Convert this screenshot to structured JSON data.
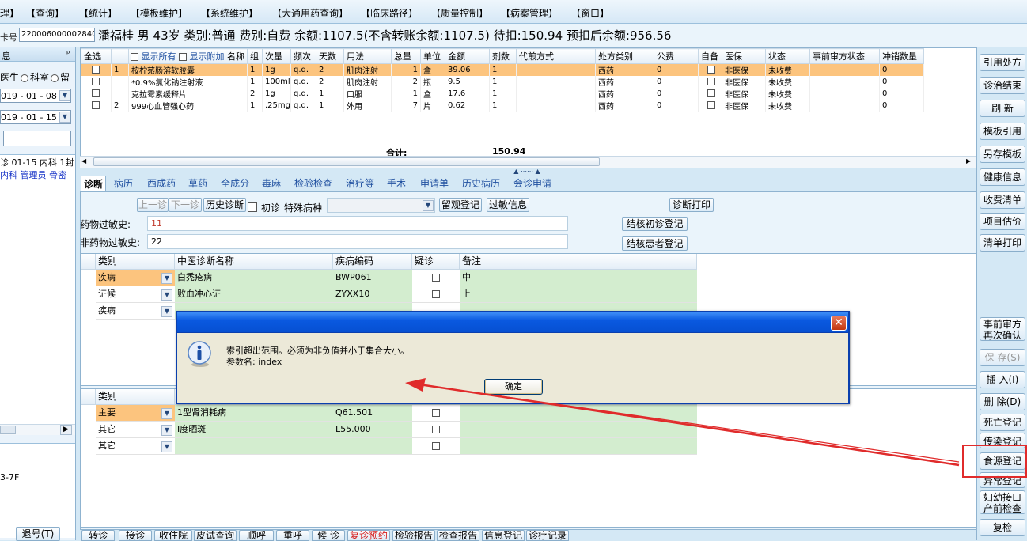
{
  "menu": [
    "理】",
    "【查询】",
    "【统计】",
    "【模板维护】",
    "【系统维护】",
    "【大通用药查询】",
    "【临床路径】",
    "【质量控制】",
    "【病案管理】",
    "【窗口】"
  ],
  "infobar": {
    "card_label": "卡号",
    "card_number": "220006000002840",
    "patient_line": "潘福桂  男  43岁  类别:普通  费别:自费  余额:1107.5(不含转账余额:1107.5)  待扣:150.94  预扣后余额:956.56"
  },
  "left_panel": {
    "header": "息",
    "pin": "ᵖ",
    "radio_doctor": "医生",
    "radio_dept": "科室",
    "radio_ward": "留",
    "date_from": "019 - 01 - 08",
    "date_to": "019 - 01 - 15",
    "visit_line1": "诊 01-15 内科 1封",
    "visit_line2": "内科 管理员 骨密",
    "code": "3-7F",
    "cancel_button": "退号(T)"
  },
  "right_buttons": [
    "引用处方",
    "诊治结束",
    "刷 新",
    "模板引用",
    "另存模板",
    "健康信息",
    "收费清单",
    "项目估价",
    "清单打印",
    "事前审方\n再次确认",
    "保 存(S)",
    "插 入(I)",
    "删 除(D)",
    "死亡登记",
    "传染登记",
    "食源登记",
    "异常登记",
    "妇幼接口\n产前检查",
    "复检"
  ],
  "rx_table": {
    "select_all": "全选",
    "show_all": "显示所有",
    "show_attached": "显示附加",
    "columns": [
      "名称",
      "组",
      "次量",
      "频次",
      "天数",
      "用法",
      "总量",
      "单位",
      "金额",
      "剂数",
      "代煎方式",
      "处方类别",
      "公费",
      "自备",
      "医保",
      "状态",
      "事前审方状态",
      "冲销数量"
    ],
    "rows": [
      {
        "no": "1",
        "name": "桉柠蒎肠溶软胶囊",
        "group": "1",
        "dose": "1g",
        "freq": "q.d.",
        "days": "2",
        "usage": "肌肉注射",
        "total": "1",
        "unit": "盒",
        "amount": "39.06",
        "doses": "1",
        "decoct": "",
        "category": "西药",
        "public": "0",
        "self": "",
        "insurance": "非医保",
        "status": "未收费",
        "audit": "",
        "offset": "0"
      },
      {
        "no": "",
        "name": "*0.9%氯化钠注射液",
        "group": "1",
        "dose": "100ml",
        "freq": "q.d.",
        "days": "2",
        "usage": "肌肉注射",
        "total": "2",
        "unit": "瓶",
        "amount": "9.5",
        "doses": "1",
        "decoct": "",
        "category": "西药",
        "public": "0",
        "self": "",
        "insurance": "非医保",
        "status": "未收费",
        "audit": "",
        "offset": "0"
      },
      {
        "no": "",
        "name": "克拉霉素缓释片",
        "group": "2",
        "dose": "1g",
        "freq": "q.d.",
        "days": "1",
        "usage": "口服",
        "total": "1",
        "unit": "盒",
        "amount": "17.6",
        "doses": "1",
        "decoct": "",
        "category": "西药",
        "public": "0",
        "self": "",
        "insurance": "非医保",
        "status": "未收费",
        "audit": "",
        "offset": "0"
      },
      {
        "no": "2",
        "name": "999心血管强心药",
        "group": "1",
        "dose": ".25mg",
        "freq": "q.d.",
        "days": "1",
        "usage": "外用",
        "total": "7",
        "unit": "片",
        "amount": "0.62",
        "doses": "1",
        "decoct": "",
        "category": "西药",
        "public": "0",
        "self": "",
        "insurance": "非医保",
        "status": "未收费",
        "audit": "",
        "offset": "0"
      }
    ],
    "total_label": "合计:",
    "total_value": "150.94"
  },
  "tabs": [
    "诊断",
    "病历",
    "西成药",
    "草药",
    "全成分",
    "毒麻",
    "检验检查",
    "治疗等",
    "手术",
    "申请单",
    "历史病历",
    "会诊申请"
  ],
  "diag": {
    "prev": "上一诊",
    "next": "下一诊",
    "history": "历史诊断",
    "first_visit": "初诊",
    "special_disease": "特殊病种",
    "observe": "留观登记",
    "allergy": "过敏信息",
    "print": "诊断打印",
    "drug_allergy_label": "药物过敏史:",
    "drug_allergy_value": "11",
    "nondrug_allergy_label": "非药物过敏史:",
    "nondrug_allergy_value": "22",
    "tb_first": "结核初诊登记",
    "tb_patient": "结核患者登记",
    "tcm_headers": [
      "类别",
      "中医诊断名称",
      "疾病编码",
      "疑诊",
      "备注"
    ],
    "tcm_rows": [
      {
        "type": "疾病",
        "name": "白秃疮病",
        "code": "BWP061",
        "note": "中"
      },
      {
        "type": "证候",
        "name": "败血冲心证",
        "code": "ZYXX10",
        "note": "上"
      },
      {
        "type": "疾病",
        "name": "",
        "code": "",
        "note": ""
      }
    ],
    "wm_headers": [
      "类别"
    ],
    "wm_rows": [
      {
        "type": "主要",
        "name": "1型肾消耗病",
        "code": "Q61.501"
      },
      {
        "type": "其它",
        "name": "Ⅰ度晒斑",
        "code": "L55.000"
      },
      {
        "type": "其它",
        "name": "",
        "code": ""
      }
    ]
  },
  "bottom_buttons": [
    "转诊",
    "接诊",
    "收住院",
    "皮试查询",
    "顺呼",
    "重呼",
    "候 诊",
    "复诊预约",
    "检验报告",
    "检查报告",
    "信息登记",
    "诊疗记录"
  ],
  "dialog": {
    "message": "索引超出范围。必须为非负值并小于集合大小。",
    "param": "参数名: index",
    "ok": "确定",
    "close": "✕"
  },
  "colors": {
    "annotation": "#e02b2b",
    "selected_row": "#fcc47e",
    "diag_cell": "#d3edcf"
  }
}
